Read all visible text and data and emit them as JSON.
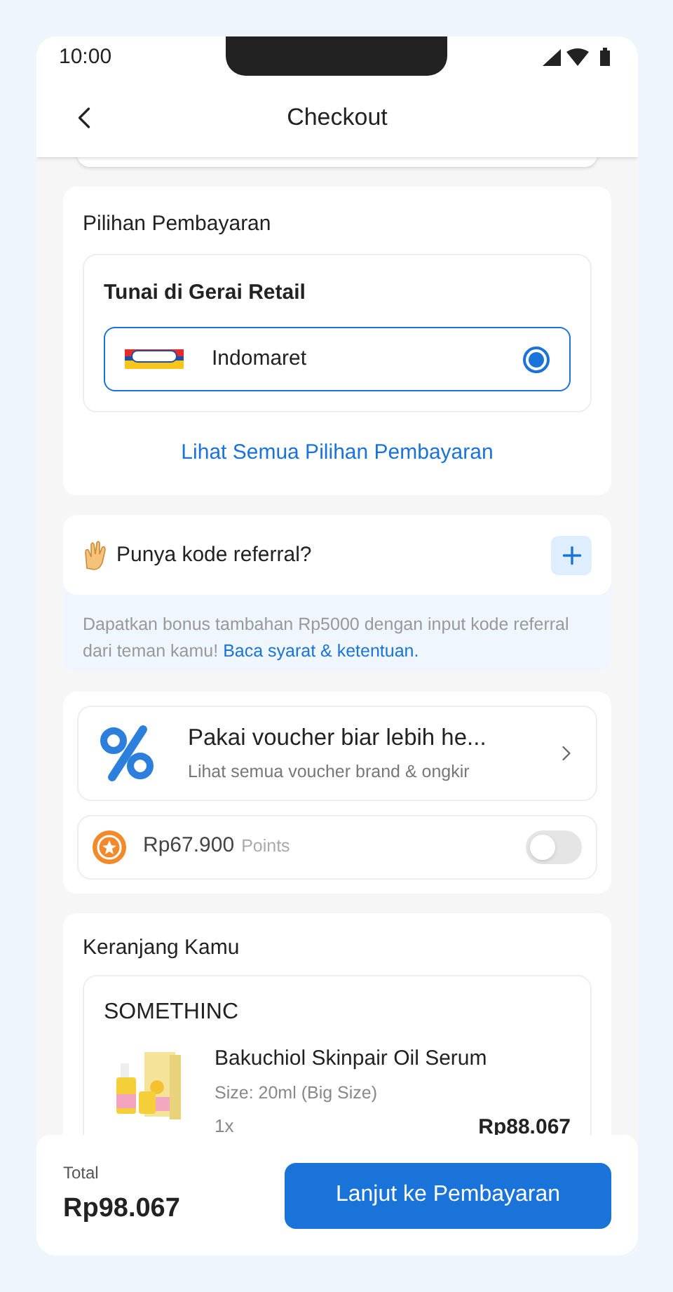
{
  "status_bar": {
    "time": "10:00"
  },
  "header": {
    "title": "Checkout"
  },
  "payment": {
    "heading": "Pilihan Pembayaran",
    "group_title": "Tunai di Gerai Retail",
    "options": [
      {
        "name": "Indomaret",
        "selected": true
      }
    ],
    "link": "Lihat Semua Pilihan Pembayaran"
  },
  "referral": {
    "title": "Punya kode referral?",
    "description": "Dapatkan bonus tambahan Rp5000 dengan input kode referral dari teman kamu!",
    "link": "Baca syarat & ketentuan."
  },
  "voucher": {
    "title": "Pakai voucher biar lebih he...",
    "subtitle": "Lihat semua voucher brand & ongkir"
  },
  "points": {
    "amount": "Rp67.900",
    "unit": "Points",
    "on": false
  },
  "cart": {
    "heading": "Keranjang Kamu",
    "store": "SOMETHINC",
    "items": [
      {
        "name": "Bakuchiol Skinpair Oil Serum",
        "variant": "Size: 20ml (Big Size)",
        "qty": "1x",
        "price": "Rp88.067"
      }
    ]
  },
  "footer": {
    "total_label": "Total",
    "total": "Rp98.067",
    "button": "Lanjut ke Pembayaran"
  }
}
